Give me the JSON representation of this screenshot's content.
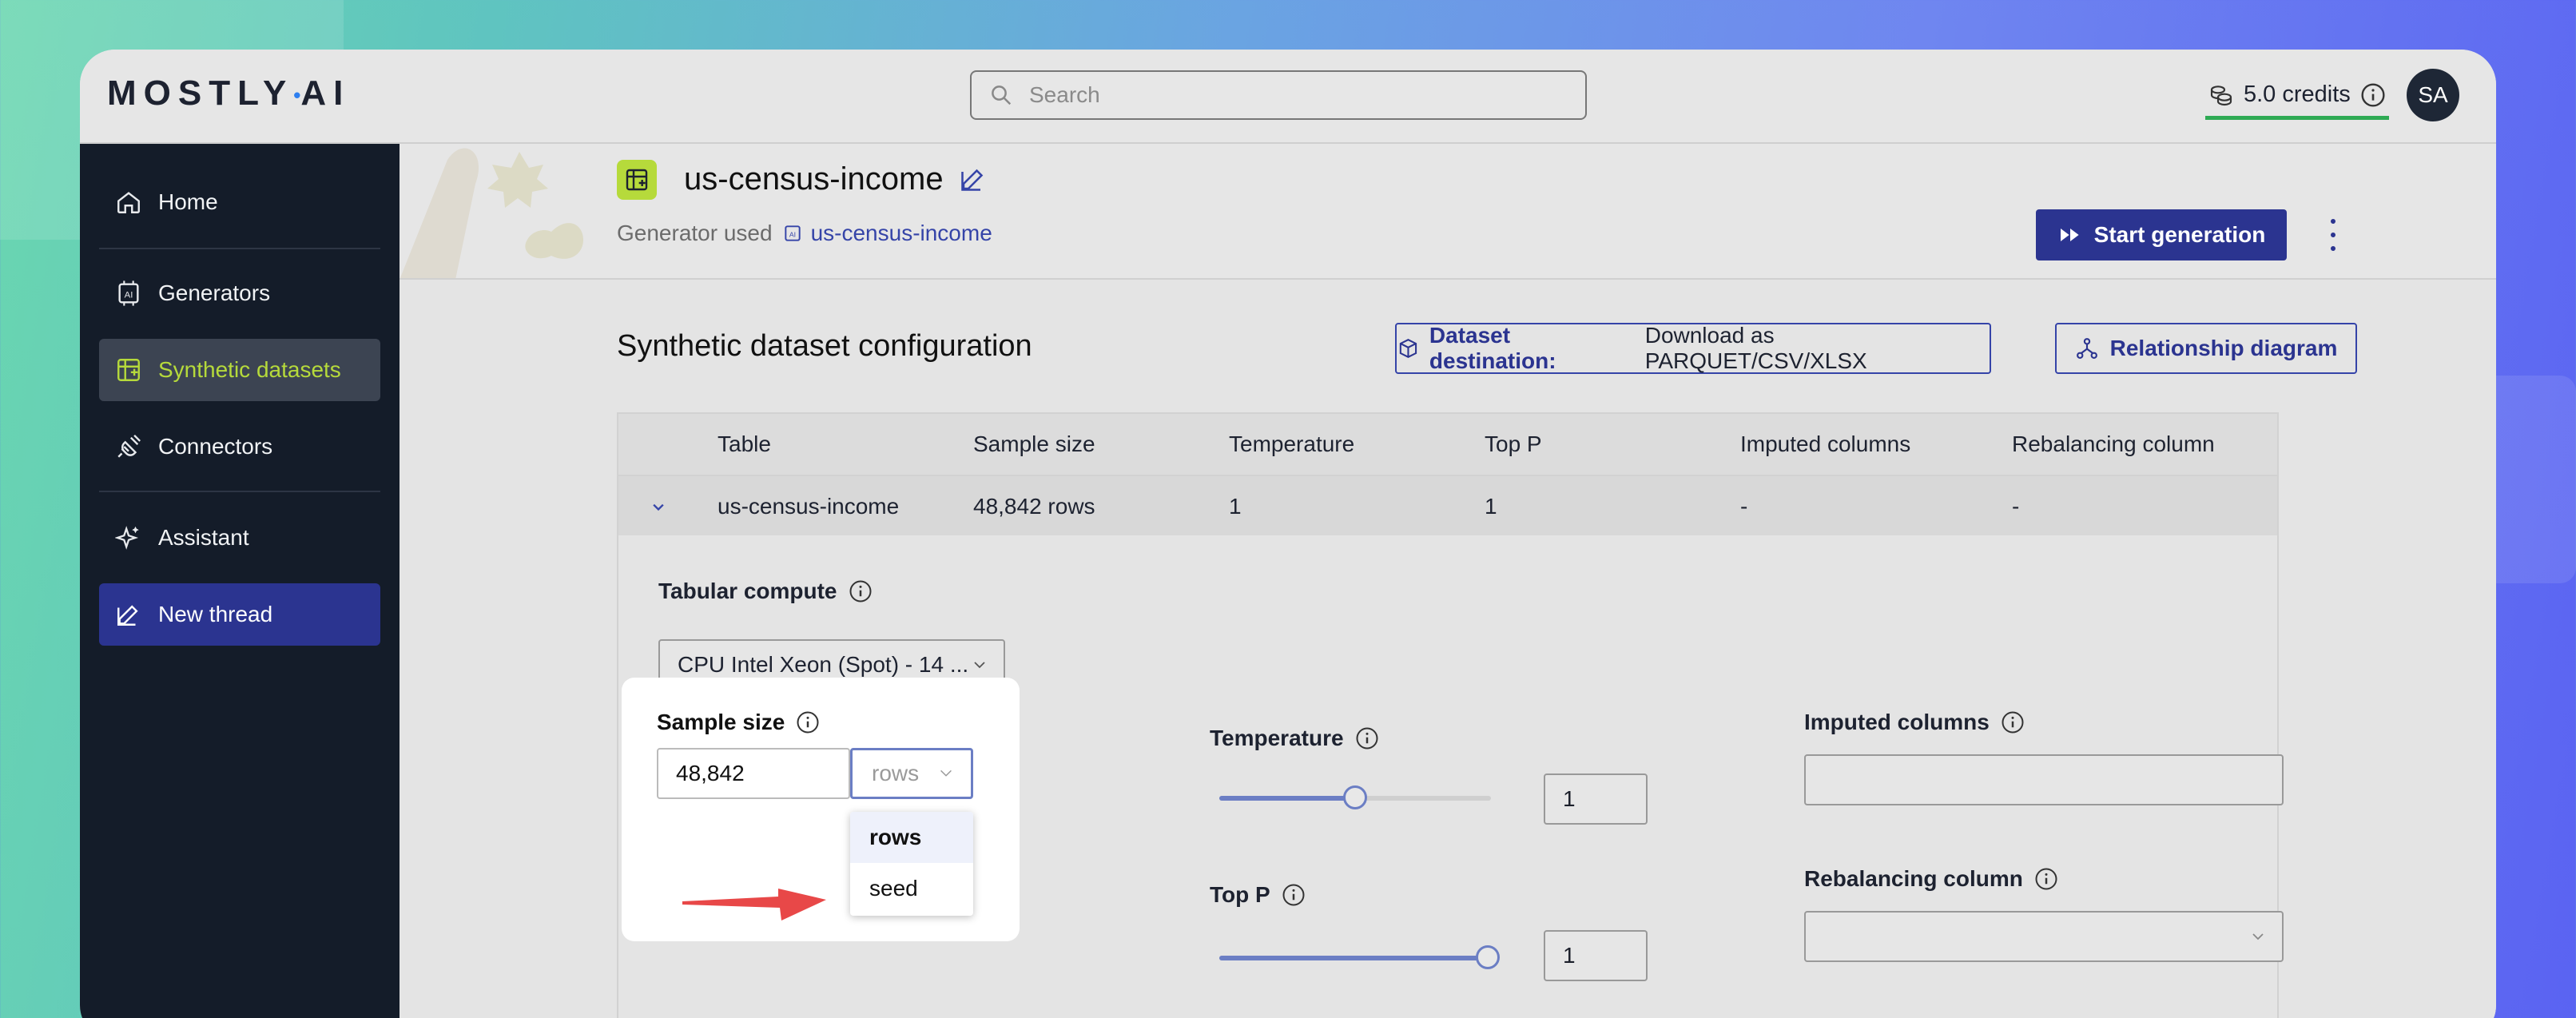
{
  "brand": {
    "logo_left": "MOSTLY",
    "logo_dot": "•",
    "logo_right": "AI"
  },
  "search": {
    "placeholder": "Search"
  },
  "account": {
    "credits": "5.0 credits",
    "avatar_initials": "SA"
  },
  "sidebar": {
    "items": [
      {
        "label": "Home",
        "icon": "home-icon"
      },
      {
        "label": "Generators",
        "icon": "ai-chip-icon"
      },
      {
        "label": "Synthetic datasets",
        "icon": "dataset-icon",
        "active": true
      },
      {
        "label": "Connectors",
        "icon": "plug-icon"
      },
      {
        "label": "Assistant",
        "icon": "sparkle-icon"
      },
      {
        "label": "New thread",
        "icon": "edit-icon"
      }
    ]
  },
  "header": {
    "title": "us-census-income",
    "generator_used_label": "Generator used",
    "generator_name": "us-census-income",
    "start_button": "Start generation"
  },
  "config": {
    "section_title": "Synthetic dataset configuration",
    "destination_label": "Dataset destination:",
    "destination_value": "Download as PARQUET/CSV/XLSX",
    "relationship_button": "Relationship diagram"
  },
  "table": {
    "columns": [
      "Table",
      "Sample size",
      "Temperature",
      "Top P",
      "Imputed columns",
      "Rebalancing column"
    ],
    "rows": [
      [
        "us-census-income",
        "48,842 rows",
        "1",
        "1",
        "-",
        "-"
      ]
    ]
  },
  "settings": {
    "compute_label": "Tabular compute",
    "compute_value": "CPU Intel Xeon (Spot) - 14 ...",
    "sample_size_label": "Sample size",
    "sample_size_value": "48,842",
    "sample_unit_value": "rows",
    "unit_options": [
      "rows",
      "seed"
    ],
    "temperature_label": "Temperature",
    "temperature_value": "1",
    "temperature_fraction": 0.5,
    "top_p_label": "Top P",
    "top_p_value": "1",
    "top_p_fraction": 1.0,
    "imputed_label": "Imputed columns",
    "rebalancing_label": "Rebalancing column"
  },
  "colors": {
    "accent": "#2b3490",
    "lime": "#b6da3b",
    "credits_bar": "#2eaa54",
    "sidebar_bg": "#141c29"
  }
}
